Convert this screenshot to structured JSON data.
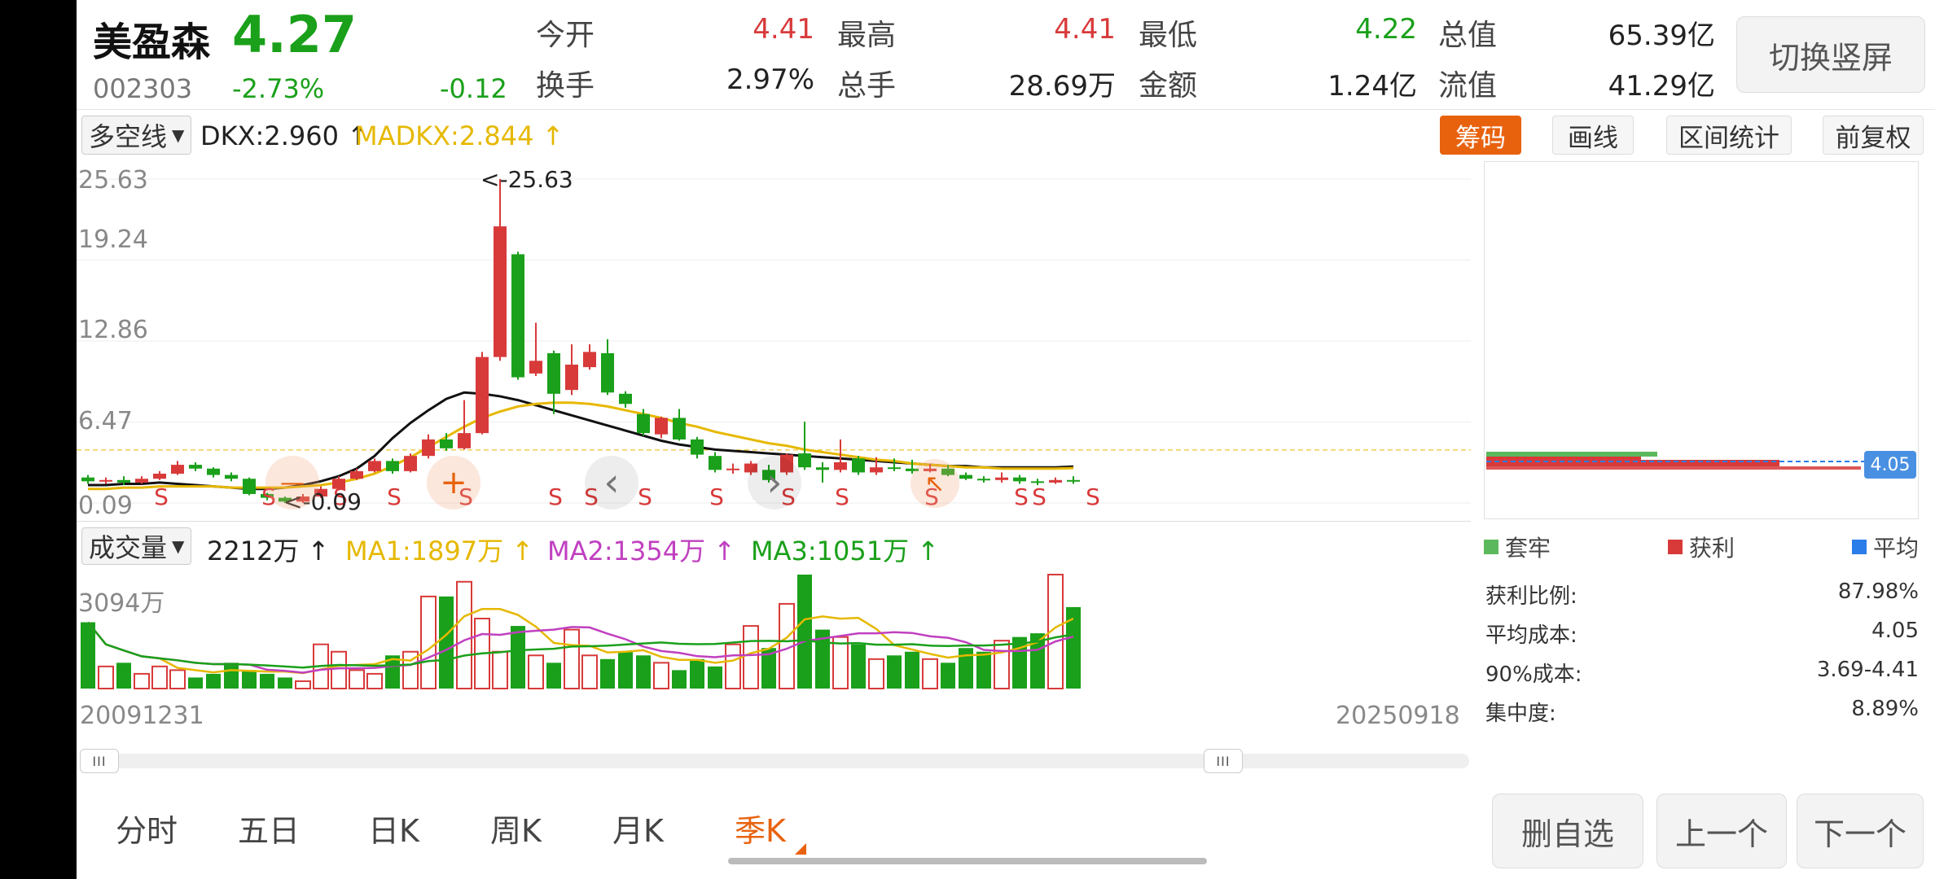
{
  "stock": {
    "name": "美盈森",
    "price": "4.27",
    "code": "002303",
    "change_pct": "-2.73%",
    "change": "-0.12"
  },
  "quote": {
    "open_label": "今开",
    "open": "4.41",
    "high_label": "最高",
    "high": "4.41",
    "low_label": "最低",
    "low": "4.22",
    "total_value_label": "总值",
    "total_value": "65.39亿",
    "turnover_label": "换手",
    "turnover": "2.97%",
    "volume_label": "总手",
    "volume": "28.69万",
    "amount_label": "金额",
    "amount": "1.24亿",
    "float_value_label": "流值",
    "float_value": "41.29亿"
  },
  "switch_button": "切换竖屏",
  "indicator": {
    "selector": "多空线",
    "dkx": "DKX:2.960",
    "madkx": "MADKX:2.844",
    "up_arrow": "↑"
  },
  "tools": {
    "chips": "筹码",
    "draw": "画线",
    "range_stats": "区间统计",
    "adjust": "前复权"
  },
  "price_chart": {
    "y_ticks": [
      "25.63",
      "19.24",
      "12.86",
      "6.47",
      "0.09"
    ],
    "max_marker": "<-25.63",
    "min_marker": "<-0.09",
    "sell_marker": "S",
    "buy_marker": "+",
    "minus_marker": "—",
    "prev_icon": "‹",
    "next_icon": "›",
    "cost_label": "4.05"
  },
  "volume": {
    "selector": "成交量",
    "value": "2212万",
    "ma1": "MA1:1897万",
    "ma2": "MA2:1354万",
    "ma3": "MA3:1051万",
    "max_label": "3094万",
    "start_date": "20091231",
    "end_date": "20250918"
  },
  "chips_legend": {
    "trapped": "套牢",
    "profit": "获利",
    "average": "平均"
  },
  "chips_stats": [
    {
      "label": "获利比例:",
      "value": "87.98%"
    },
    {
      "label": "平均成本:",
      "value": "4.05"
    },
    {
      "label": "90%成本:",
      "value": "3.69-4.41"
    },
    {
      "label": "集中度:",
      "value": "8.89%"
    }
  ],
  "periods": [
    "分时",
    "五日",
    "日K",
    "周K",
    "月K",
    "季K"
  ],
  "active_period": "季K",
  "slider_handle": "III",
  "bottom_buttons": {
    "delete_fav": "删自选",
    "prev": "上一个",
    "next": "下一个"
  },
  "colors": {
    "up": "#d83a3a",
    "down": "#1aa01a",
    "accent": "#e8620e",
    "ma1": "#e6b800",
    "ma2": "#c040c0",
    "ma3": "#1aa01a",
    "dkx": "#111111",
    "madkx": "#e6b800"
  },
  "chart_data": [
    {
      "type": "candlestick",
      "title": "",
      "ylim": [
        0.09,
        25.63
      ],
      "series": [
        {
          "name": "DKX",
          "values": [
            1.5,
            1.5,
            1.6,
            1.6,
            1.7,
            1.6,
            1.5,
            1.4,
            1.3,
            1.2,
            1.2,
            1.3,
            1.5,
            1.8,
            2.2,
            2.8,
            3.8,
            5.2,
            6.4,
            7.4,
            8.3,
            8.8,
            8.7,
            8.5,
            8.2,
            7.8,
            7.4,
            7.0,
            6.6,
            6.2,
            5.8,
            5.4,
            5.0,
            4.7,
            4.5,
            4.3,
            4.2,
            4.1,
            4.0,
            3.9,
            3.8,
            3.7,
            3.6,
            3.5,
            3.4,
            3.3,
            3.2,
            3.1,
            3.0,
            3.0,
            2.9,
            2.9,
            2.9,
            2.9,
            2.9,
            2.96
          ]
        },
        {
          "name": "MADKX",
          "values": [
            1.2,
            1.2,
            1.3,
            1.3,
            1.4,
            1.4,
            1.4,
            1.4,
            1.3,
            1.3,
            1.3,
            1.3,
            1.4,
            1.5,
            1.7,
            2.0,
            2.4,
            3.0,
            3.7,
            4.5,
            5.3,
            6.1,
            6.8,
            7.3,
            7.7,
            7.9,
            8.0,
            8.0,
            7.9,
            7.7,
            7.4,
            7.1,
            6.8,
            6.4,
            6.1,
            5.7,
            5.4,
            5.1,
            4.8,
            4.6,
            4.3,
            4.1,
            3.9,
            3.7,
            3.5,
            3.4,
            3.2,
            3.1,
            3.0,
            2.9,
            2.9,
            2.8,
            2.8,
            2.8,
            2.8,
            2.844
          ]
        }
      ],
      "candles": [
        {
          "o": 2.1,
          "c": 1.8,
          "h": 2.3,
          "l": 1.6
        },
        {
          "o": 1.8,
          "c": 1.9,
          "h": 2.1,
          "l": 1.6
        },
        {
          "o": 1.9,
          "c": 1.7,
          "h": 2.2,
          "l": 1.5
        },
        {
          "o": 1.7,
          "c": 2.0,
          "h": 2.2,
          "l": 1.6
        },
        {
          "o": 2.0,
          "c": 2.4,
          "h": 2.6,
          "l": 1.9
        },
        {
          "o": 2.4,
          "c": 3.1,
          "h": 3.4,
          "l": 2.3
        },
        {
          "o": 3.1,
          "c": 2.8,
          "h": 3.3,
          "l": 2.6
        },
        {
          "o": 2.8,
          "c": 2.3,
          "h": 2.9,
          "l": 2.1
        },
        {
          "o": 2.3,
          "c": 2.0,
          "h": 2.5,
          "l": 1.8
        },
        {
          "o": 2.0,
          "c": 0.8,
          "h": 2.1,
          "l": 0.7
        },
        {
          "o": 0.8,
          "c": 0.5,
          "h": 0.9,
          "l": 0.3
        },
        {
          "o": 0.5,
          "c": 0.2,
          "h": 0.6,
          "l": 0.09
        },
        {
          "o": 0.2,
          "c": 0.6,
          "h": 0.8,
          "l": 0.1
        },
        {
          "o": 0.6,
          "c": 1.2,
          "h": 1.4,
          "l": 0.5
        },
        {
          "o": 1.2,
          "c": 2.0,
          "h": 2.2,
          "l": 1.1
        },
        {
          "o": 2.0,
          "c": 2.6,
          "h": 2.8,
          "l": 1.9
        },
        {
          "o": 2.6,
          "c": 3.4,
          "h": 3.6,
          "l": 2.5
        },
        {
          "o": 3.4,
          "c": 2.6,
          "h": 3.6,
          "l": 2.4
        },
        {
          "o": 2.6,
          "c": 3.8,
          "h": 4.0,
          "l": 2.5
        },
        {
          "o": 3.8,
          "c": 5.1,
          "h": 5.5,
          "l": 3.6
        },
        {
          "o": 5.1,
          "c": 4.4,
          "h": 5.6,
          "l": 4.2
        },
        {
          "o": 4.4,
          "c": 5.6,
          "h": 8.2,
          "l": 4.3
        },
        {
          "o": 5.6,
          "c": 11.6,
          "h": 12.0,
          "l": 5.5
        },
        {
          "o": 11.6,
          "c": 21.9,
          "h": 25.63,
          "l": 11.3
        },
        {
          "o": 19.7,
          "c": 10.0,
          "h": 19.9,
          "l": 9.8
        },
        {
          "o": 10.3,
          "c": 11.3,
          "h": 14.3,
          "l": 10.1
        },
        {
          "o": 11.9,
          "c": 8.7,
          "h": 12.1,
          "l": 7.1
        },
        {
          "o": 9.0,
          "c": 11.0,
          "h": 12.6,
          "l": 8.6
        },
        {
          "o": 10.8,
          "c": 12.0,
          "h": 12.6,
          "l": 10.6
        },
        {
          "o": 11.9,
          "c": 8.8,
          "h": 13.0,
          "l": 8.6
        },
        {
          "o": 8.7,
          "c": 7.9,
          "h": 8.9,
          "l": 7.6
        },
        {
          "o": 7.1,
          "c": 5.6,
          "h": 7.5,
          "l": 5.4
        },
        {
          "o": 5.5,
          "c": 6.8,
          "h": 6.9,
          "l": 5.2
        },
        {
          "o": 6.8,
          "c": 5.1,
          "h": 7.5,
          "l": 5.0
        },
        {
          "o": 5.1,
          "c": 3.9,
          "h": 5.3,
          "l": 3.6
        },
        {
          "o": 3.8,
          "c": 2.7,
          "h": 4.1,
          "l": 2.5
        },
        {
          "o": 2.8,
          "c": 2.8,
          "h": 3.2,
          "l": 2.4
        },
        {
          "o": 2.5,
          "c": 3.2,
          "h": 3.4,
          "l": 2.3
        },
        {
          "o": 2.7,
          "c": 1.9,
          "h": 3.1,
          "l": 1.7
        },
        {
          "o": 2.5,
          "c": 3.9,
          "h": 4.0,
          "l": 2.3
        },
        {
          "o": 4.0,
          "c": 2.9,
          "h": 6.5,
          "l": 2.7
        },
        {
          "o": 2.9,
          "c": 2.7,
          "h": 3.3,
          "l": 1.7
        },
        {
          "o": 2.7,
          "c": 3.3,
          "h": 5.1,
          "l": 2.5
        },
        {
          "o": 3.6,
          "c": 2.5,
          "h": 3.8,
          "l": 2.3
        },
        {
          "o": 2.5,
          "c": 2.9,
          "h": 3.7,
          "l": 2.3
        },
        {
          "o": 2.9,
          "c": 2.8,
          "h": 3.6,
          "l": 2.6
        },
        {
          "o": 2.8,
          "c": 2.6,
          "h": 3.5,
          "l": 2.4
        },
        {
          "o": 2.6,
          "c": 2.8,
          "h": 3.2,
          "l": 2.5
        },
        {
          "o": 2.8,
          "c": 2.3,
          "h": 3.1,
          "l": 2.2
        },
        {
          "o": 2.3,
          "c": 2.0,
          "h": 2.5,
          "l": 1.9
        },
        {
          "o": 2.0,
          "c": 1.9,
          "h": 2.2,
          "l": 1.7
        },
        {
          "o": 1.9,
          "c": 2.1,
          "h": 2.5,
          "l": 1.7
        },
        {
          "o": 2.1,
          "c": 1.8,
          "h": 2.3,
          "l": 1.6
        },
        {
          "o": 1.8,
          "c": 1.7,
          "h": 2.0,
          "l": 1.5
        },
        {
          "o": 1.7,
          "c": 1.9,
          "h": 2.1,
          "l": 1.6
        },
        {
          "o": 1.9,
          "c": 1.8,
          "h": 2.2,
          "l": 1.6
        }
      ]
    },
    {
      "type": "bar",
      "title": "",
      "ylim": [
        0,
        3094
      ],
      "series": [
        {
          "name": "MA1",
          "values": []
        },
        {
          "name": "MA2",
          "values": []
        },
        {
          "name": "MA3",
          "values": []
        }
      ]
    }
  ]
}
